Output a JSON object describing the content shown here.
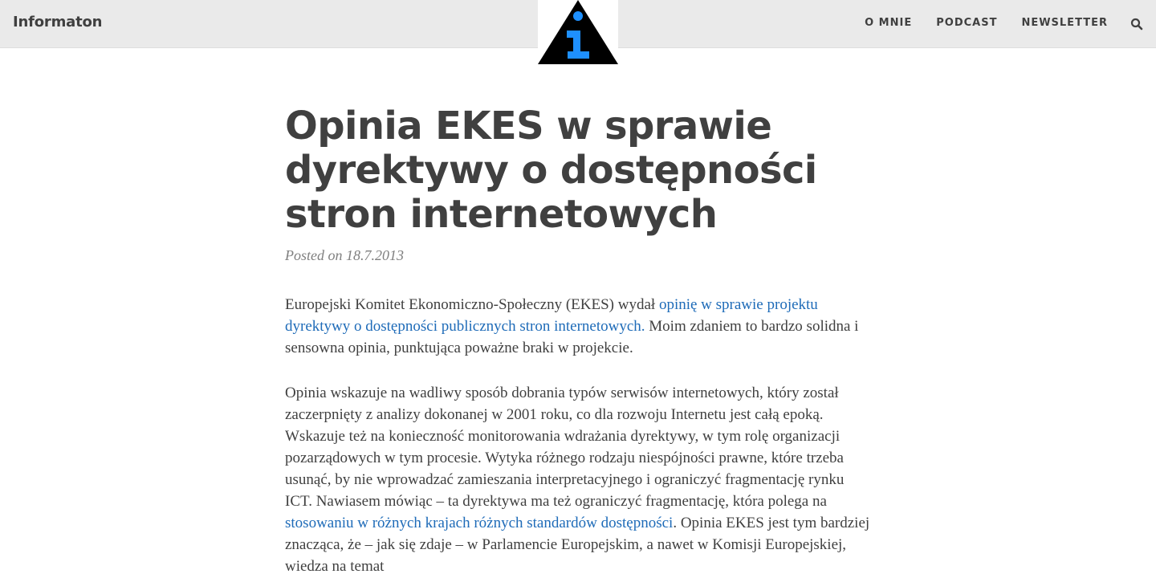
{
  "site": {
    "brand": "Informaton"
  },
  "nav": {
    "items": [
      "O MNIE",
      "PODCAST",
      "NEWSLETTER"
    ]
  },
  "icons": {
    "search": "search-icon",
    "logo": "info-triangle-logo"
  },
  "colors": {
    "topbar_bg": "#eaeaea",
    "text": "#404040",
    "link": "#1e6bb8",
    "logo_blue": "#1e90ff",
    "logo_black": "#000000"
  },
  "article": {
    "title": "Opinia EKES w sprawie dyrektywy o dostępności stron internetowych",
    "posted_prefix": "Posted on",
    "date": "18.7.2013",
    "p1": {
      "t1": "Europejski Komitet Ekonomiczno-Społeczny (EKES) wydał ",
      "link": "opinię w sprawie projektu dyrektywy o dostępności publicznych stron internetowych.",
      "t2": " Moim zdaniem to bardzo solidna i sensowna opinia, punktująca poważne braki w projekcie."
    },
    "p2": {
      "t1": "Opinia wskazuje na wadliwy sposób dobrania typów serwisów internetowych, który został zaczerpnięty z analizy dokonanej w 2001 roku, co dla rozwoju Internetu jest całą epoką. Wskazuje też na konieczność monitorowania wdrażania dyrektywy, w tym rolę organizacji pozarządowych w tym procesie. Wytyka różnego rodzaju niespójności prawne, które trzeba usunąć, by nie wprowadzać zamieszania interpretacyjnego i ograniczyć fragmentację rynku ICT. Nawiasem mówiąc – ta dyrektywa ma też ograniczyć fragmentację, która polega na ",
      "link": "stosowaniu w różnych krajach różnych standardów dostępności",
      "t2": ". Opinia EKES jest tym bardziej znacząca, że – jak się zdaje – w Parlamencie Europejskim, a nawet w Komisji Europejskiej, wiedza na temat"
    }
  }
}
